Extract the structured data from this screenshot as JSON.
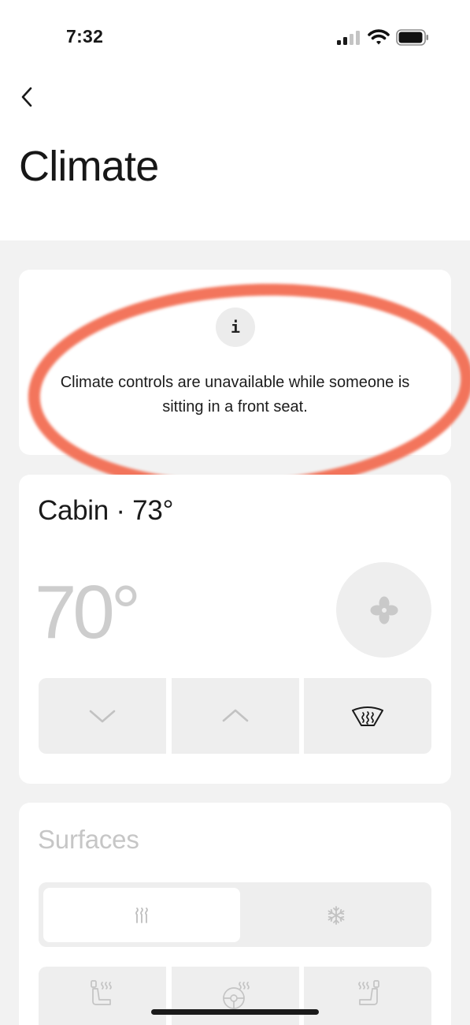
{
  "status_bar": {
    "time": "7:32"
  },
  "header": {
    "title": "Climate"
  },
  "notice": {
    "icon_letter": "i",
    "message": "Climate controls are unavailable while someone is sitting in a front seat.",
    "highlight_color": "#f26a50"
  },
  "cabin": {
    "label": "Cabin · 73°",
    "set_temperature": "70°"
  },
  "surfaces": {
    "title": "Surfaces",
    "modes": [
      "heat",
      "cool"
    ],
    "selected_mode": "heat"
  },
  "icons": [
    "back-chevron",
    "info",
    "fan",
    "chevron-down",
    "chevron-up",
    "windshield-defrost",
    "heat-waves",
    "snowflake",
    "seat-heat"
  ]
}
